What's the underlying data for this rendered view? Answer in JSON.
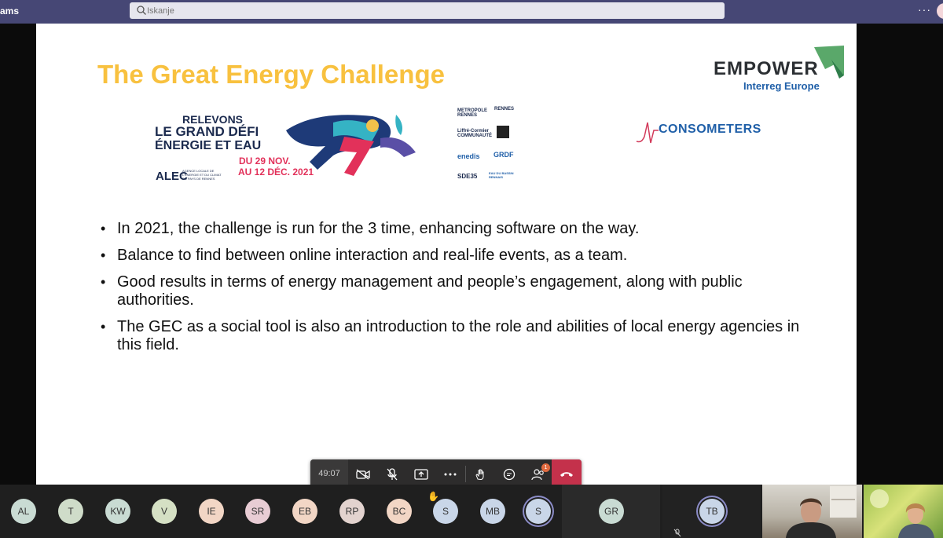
{
  "titlebar": {
    "app_name": "ams",
    "search_placeholder": "Iskanje",
    "more_label": "···"
  },
  "slide": {
    "title": "The Great Energy Challenge",
    "empower": {
      "name": "EMPOWER",
      "sub": "Interreg Europe"
    },
    "consometers": "CONSOMETERS",
    "banner": {
      "line1": "RELEVONS",
      "line2": "LE GRAND DÉFI",
      "line3": "ÉNERGIE ET EAU",
      "date1": "DU 29 NOV.",
      "date2": "AU 12 DÉC. 2021",
      "alec": "ALEC",
      "alec_sub": "AGENCE LOCALE DE L'ÉNERGIE ET DU CLIMAT DU PAYS DE RENNES",
      "partners": [
        "METROPOLE RENNES",
        "RENNES",
        "Liffré-Cormier COMMUNAUTÉ",
        "",
        "enedis",
        "GRDF",
        "SDE35",
        "EAU DU BASSIN RENNAIS"
      ]
    },
    "bullets": [
      "In 2021, the challenge is run for the 3   time, enhancing software on the way.",
      "Balance to find between online interaction and real-life events, as a team.",
      "Good results in terms of energy management and people’s engagement, along with public authorities.",
      "The GEC as a social tool is also an introduction to the role and abilities of local energy agencies in this field."
    ]
  },
  "controls": {
    "timer": "49:07",
    "participants_badge": "1",
    "icons": [
      "camera-off-icon",
      "mic-off-icon",
      "share-screen-icon",
      "more-icon",
      "raise-hand-icon",
      "chat-icon",
      "participants-icon",
      "hang-up-icon"
    ]
  },
  "participants": [
    {
      "initials": "AL",
      "bg": "#c9dbd3"
    },
    {
      "initials": "T",
      "bg": "#cfdcc9"
    },
    {
      "initials": "KW",
      "bg": "#c9dbd3"
    },
    {
      "initials": "V",
      "bg": "#d5e0c4"
    },
    {
      "initials": "IE",
      "bg": "#f2d6c5"
    },
    {
      "initials": "SR",
      "bg": "#e8ccd4"
    },
    {
      "initials": "EB",
      "bg": "#f2d6c5"
    },
    {
      "initials": "RP",
      "bg": "#e3d3cf"
    },
    {
      "initials": "BC",
      "bg": "#f2d6c5"
    },
    {
      "initials": "S",
      "bg": "#c9d6e8",
      "raised_hand": true
    },
    {
      "initials": "MB",
      "bg": "#c9d6e8"
    },
    {
      "initials": "S",
      "bg": "#c9d6e8",
      "active": true
    }
  ],
  "gr_initials": "GR",
  "tb_initials": "TB",
  "colors": {
    "title_gold": "#f8c13f",
    "teams_purple": "#464775",
    "hangup_red": "#c4314b",
    "empower_green": "#5aa86a"
  }
}
